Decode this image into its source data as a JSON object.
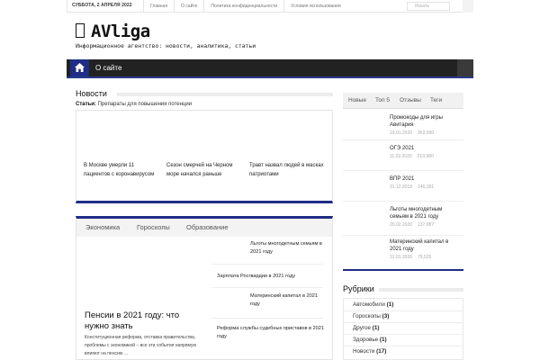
{
  "topbar": {
    "date": "суббота, 2 апреля 2022",
    "links": [
      "Главная",
      "О сайте",
      "Политика конфиденциальности",
      "Условия использования"
    ],
    "search_placeholder": "Искать"
  },
  "header": {
    "logo_text": "AVliga",
    "tagline": "Информационное агентство: новости, аналитика, статьи"
  },
  "mainnav": {
    "items": [
      "О сайте"
    ]
  },
  "news": {
    "title": "Новости",
    "ticker_label": "Статьи:",
    "ticker_text": "Препараты для повышения потенции",
    "cards": [
      "В Москве умерли 11 пациентов с коронавирусом",
      "Сезон смерчей на Черном море начался раньше",
      "Травт назвал людей в масках патриотами"
    ]
  },
  "categories": {
    "tabs": [
      "Экономика",
      "Гороскопы",
      "Образование"
    ],
    "featured_title": "Пенсии в 2021 году: что нужно знать",
    "featured_excerpt": "Конституционная реформа, отставка правительства, проблемы с экономикой – все эти события напрямую влияют на пенсию ...",
    "list": [
      "Льготы многодетным семьям в 2021 году",
      "Зарплата Росгвардии в 2021 году",
      "Материнский капитал в 2021 году",
      "Реформа службы судебных приставов в 2021 году"
    ]
  },
  "sidebar": {
    "tabs": [
      "Новые",
      "Топ 5",
      "Отзывы",
      "Теги"
    ],
    "items": [
      {
        "title": "Промокоды для игры Авитария",
        "date": "19.01.2020",
        "views": "352,690"
      },
      {
        "title": "ОГЭ 2021",
        "date": "11.02.2020",
        "views": "219,980"
      },
      {
        "title": "ВПР 2021",
        "date": "31.12.2019",
        "views": "146,391"
      },
      {
        "title": "Льготы многодетным семьям в 2021 году",
        "date": "20.02.2020",
        "views": "137,987"
      },
      {
        "title": "Материнский капитал в 2021 году",
        "date": "31.01.2020",
        "views": "75,525"
      }
    ],
    "rubrics_title": "Рубрики",
    "rubrics": [
      {
        "name": "Автомобили",
        "count": "(1)"
      },
      {
        "name": "Гороскопы",
        "count": "(3)"
      },
      {
        "name": "Другое",
        "count": "(1)"
      },
      {
        "name": "Здоровье",
        "count": "(1)"
      },
      {
        "name": "Новости",
        "count": "(17)"
      }
    ]
  },
  "colors": {
    "accent": "#1f2d86",
    "nav_bg": "#222222"
  }
}
